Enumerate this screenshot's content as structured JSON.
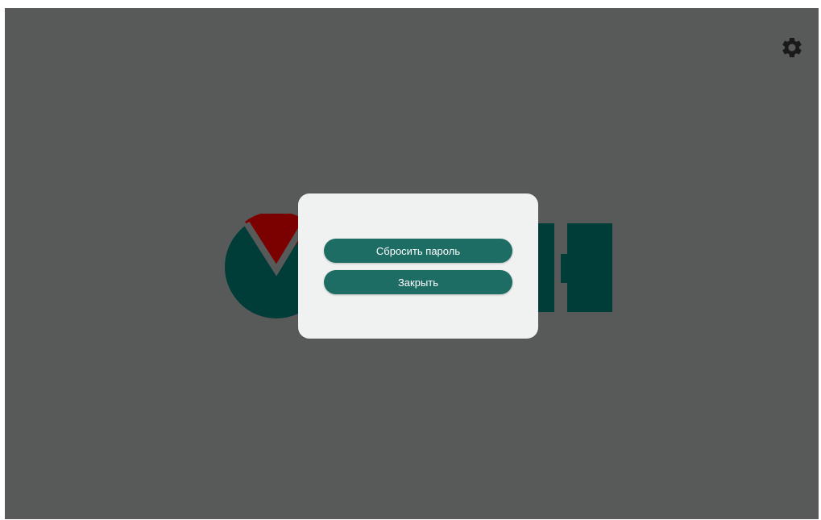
{
  "header": {
    "settings_icon": "gear-icon"
  },
  "logo": {
    "primary_color": "#003c38",
    "accent_color": "#7b0000"
  },
  "dialog": {
    "reset_password_label": "Сбросить пароль",
    "close_label": "Закрыть",
    "button_color": "#1e6d64",
    "background_color": "#f0f2f1"
  },
  "colors": {
    "overlay_background": "#585a59"
  }
}
